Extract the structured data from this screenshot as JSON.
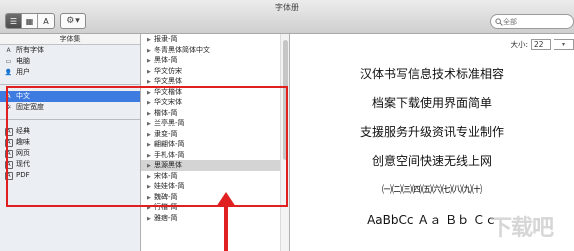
{
  "window": {
    "title": "字体册"
  },
  "toolbar": {
    "view_buttons": [
      "☰",
      "▦",
      "A"
    ],
    "search_placeholder": "全部",
    "gear_icon": "⚙",
    "gear_caret": "▾"
  },
  "collections": {
    "header": "字体集",
    "top": [
      {
        "label": "所有字体",
        "icon": "fonts-icon",
        "glyph": "A"
      },
      {
        "label": "电脑",
        "icon": "computer-icon",
        "glyph": "▭"
      },
      {
        "label": "用户",
        "icon": "user-icon",
        "glyph": "👤"
      }
    ],
    "mid": [
      {
        "label": "中文",
        "icon": "book-icon",
        "glyph": "A",
        "selected": true
      },
      {
        "label": "固定宽度",
        "icon": "gear-small-icon",
        "glyph": "✲"
      }
    ],
    "bottom": [
      {
        "label": "经典",
        "glyph": "A"
      },
      {
        "label": "趣味",
        "glyph": "A"
      },
      {
        "label": "网页",
        "glyph": "A"
      },
      {
        "label": "现代",
        "glyph": "A"
      },
      {
        "label": "PDF",
        "glyph": "A"
      }
    ]
  },
  "families": [
    "报隶-简",
    "冬青黑体简体中文",
    "黑体-简",
    "华文仿宋",
    "华文黑体",
    "华文楷体",
    "华文宋体",
    "楷体-简",
    "兰亭黑-简",
    "隶变-简",
    "翩翩体-简",
    "手札体-简",
    "思源黑体",
    "宋体-简",
    "娃娃体-简",
    "魏碑-简",
    "行楷-简",
    "雅痞-简"
  ],
  "selected_family": "思源黑体",
  "preview": {
    "size_label": "大小:",
    "size_value": "22",
    "size_spinner": "▾",
    "lines": [
      "汉体书写信息技术标准相容",
      "档案下载使用界面简单",
      "支援服务升级资讯专业制作",
      "创意空间快速无线上网",
      "㈠㈡㈢㈣㈤㈥㈦㈧㈨㈩",
      "AaBbCc Ａａ Ｂｂ Ｃｃ"
    ]
  },
  "colors": {
    "selection": "#3e7be0",
    "annotation": "#e02020"
  },
  "watermark": "下载吧"
}
